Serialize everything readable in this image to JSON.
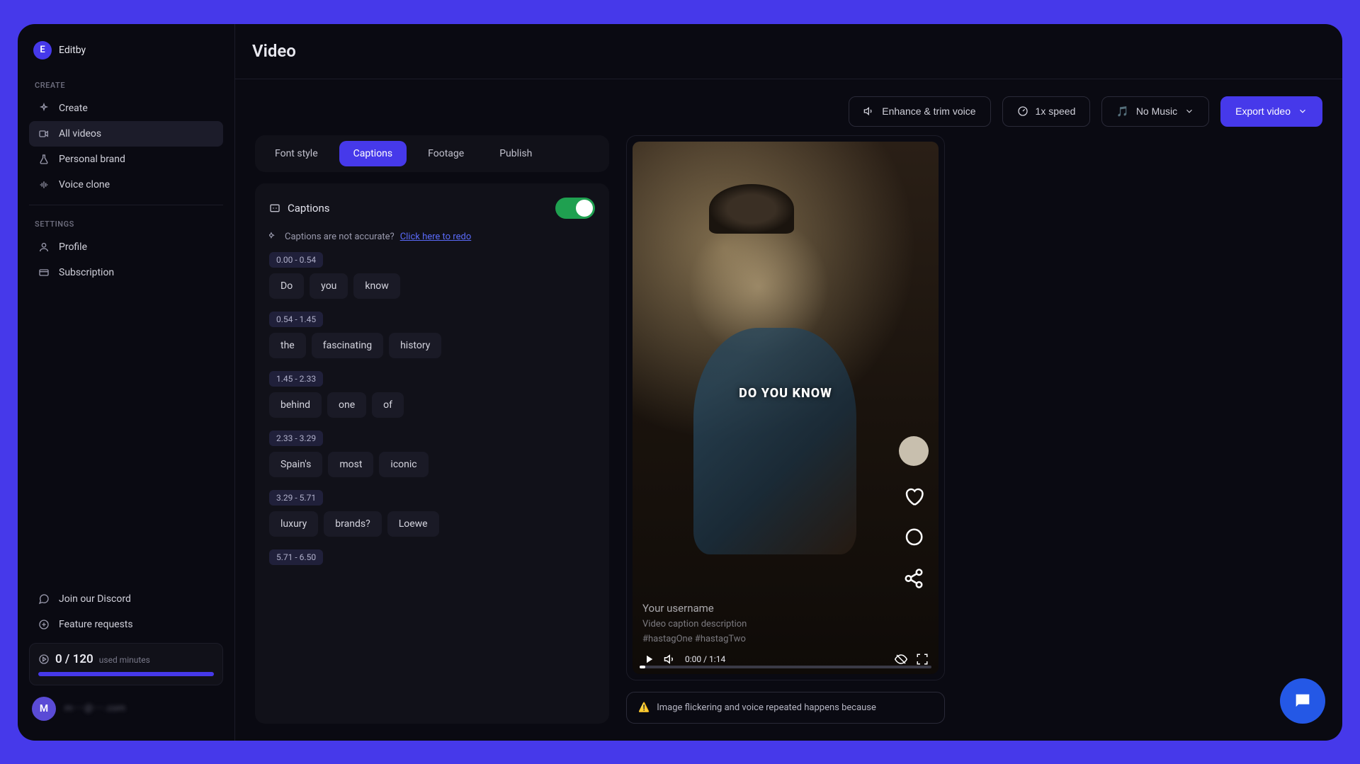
{
  "brand": {
    "initial": "E",
    "name": "Editby"
  },
  "sidebar": {
    "create_label": "CREATE",
    "settings_label": "SETTINGS",
    "items": {
      "create": "Create",
      "all_videos": "All videos",
      "personal_brand": "Personal brand",
      "voice_clone": "Voice clone",
      "profile": "Profile",
      "subscription": "Subscription",
      "discord": "Join our Discord",
      "feature_requests": "Feature requests"
    },
    "usage": {
      "count": "0 / 120",
      "label": "used minutes"
    },
    "user": {
      "initial": "M",
      "email": "m·····@·····.com"
    }
  },
  "header": {
    "title": "Video"
  },
  "toolbar": {
    "enhance": "Enhance & trim voice",
    "speed": "1x speed",
    "music": "No Music",
    "music_emoji": "🎵",
    "export": "Export video"
  },
  "tabs": {
    "font_style": "Font style",
    "captions": "Captions",
    "footage": "Footage",
    "publish": "Publish"
  },
  "captions": {
    "title": "Captions",
    "redo_prompt": "Captions are not accurate?",
    "redo_link": "Click here to redo",
    "blocks": [
      {
        "time": "0.00 - 0.54",
        "words": [
          "Do",
          "you",
          "know"
        ]
      },
      {
        "time": "0.54 - 1.45",
        "words": [
          "the",
          "fascinating",
          "history"
        ]
      },
      {
        "time": "1.45 - 2.33",
        "words": [
          "behind",
          "one",
          "of"
        ]
      },
      {
        "time": "2.33 - 3.29",
        "words": [
          "Spain's",
          "most",
          "iconic"
        ]
      },
      {
        "time": "3.29 - 5.71",
        "words": [
          "luxury",
          "brands?",
          "Loewe"
        ]
      },
      {
        "time": "5.71 - 6.50",
        "words": []
      }
    ]
  },
  "preview": {
    "caption_overlay": "DO YOU KNOW",
    "username": "Your username",
    "description": "Video caption description",
    "tags": "#hastagOne #hastagTwo",
    "time": "0:00 / 1:14"
  },
  "warning": {
    "icon": "⚠️",
    "text": "Image flickering and voice repeated happens because"
  }
}
